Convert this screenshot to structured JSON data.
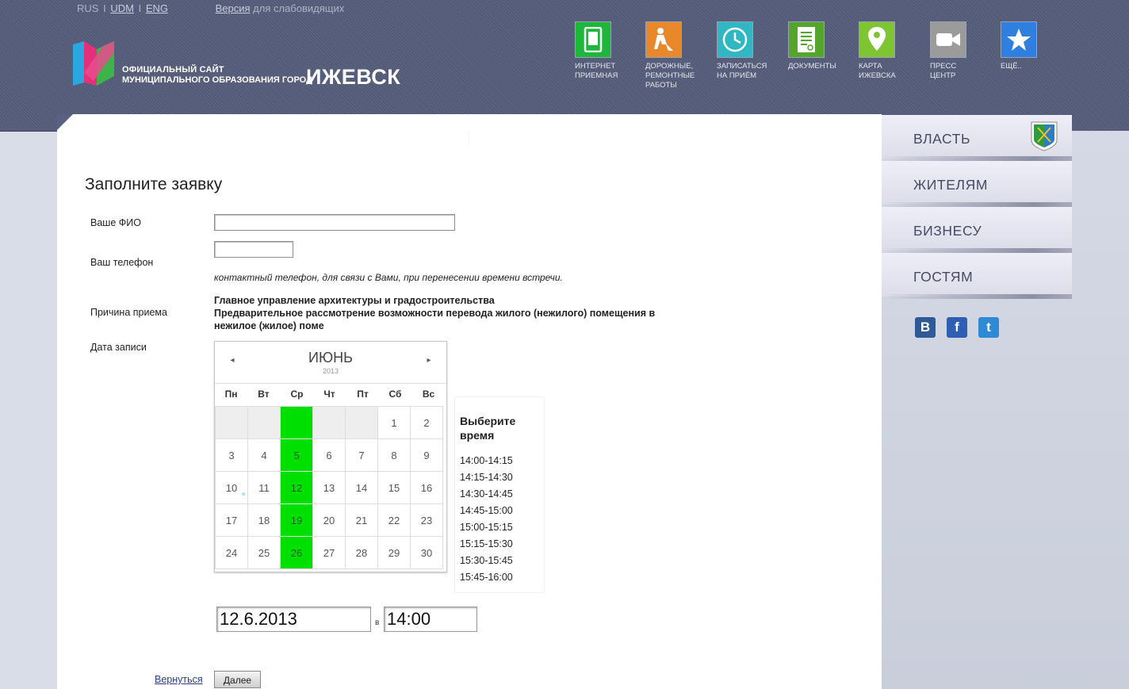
{
  "header": {
    "lang": {
      "rus": "RUS",
      "udm": "UDM",
      "eng": "ENG",
      "sep": "I"
    },
    "version_link": "Версия",
    "version_suffix": "для слабовидящих",
    "logo_line1": "ОФИЦИАЛЬНЫЙ САЙТ",
    "logo_line2": "МУНИЦИПАЛЬНОГО ОБРАЗОВАНИЯ ГОРОД",
    "logo_city": "ИЖЕВСК",
    "quick": [
      {
        "label1": "ИНТЕРНЕТ",
        "label2": "ПРИЕМНАЯ",
        "label3": "",
        "icon": "tablet-icon",
        "color": "#1fb63c"
      },
      {
        "label1": "ДОРОЖНЫЕ,",
        "label2": "РЕМОНТНЫЕ",
        "label3": "РАБОТЫ",
        "icon": "roadwork-icon",
        "color": "#e8882a"
      },
      {
        "label1": "ЗАПИСАТЬСЯ",
        "label2": "НА ПРИЁМ",
        "label3": "",
        "icon": "clock-icon",
        "color": "#2fb8c4"
      },
      {
        "label1": "ДОКУМЕНТЫ",
        "label2": "",
        "label3": "",
        "icon": "document-icon",
        "color": "#53a52b"
      },
      {
        "label1": "КАРТА",
        "label2": "ИЖЕВСКА",
        "label3": "",
        "icon": "map-pin-icon",
        "color": "#7ec433"
      },
      {
        "label1": "ПРЕСС",
        "label2": "ЦЕНТР",
        "label3": "",
        "icon": "camera-icon",
        "color": "#9b9b9b"
      },
      {
        "label1": "ЕЩЁ..",
        "label2": "",
        "label3": "",
        "icon": "star-icon",
        "color": "#2f7fe0"
      }
    ]
  },
  "form": {
    "title": "Заполните заявку",
    "fio_label": "Ваше ФИО",
    "fio_value": "",
    "phone_label": "Ваш телефон",
    "phone_value": "",
    "phone_hint": "контактный телефон, для связи с Вами, при перенесении времени встречи.",
    "reason_label": "Причина приема",
    "reason_line1": "Главное управление архитектуры и градостроительства",
    "reason_line2": "Предварительное рассмотрение возможности перевода жилого (нежилого) помещения в нежилое (жилое) поме",
    "date_label": "Дата записи",
    "selected_date": "12.6.2013",
    "at_label": "в",
    "selected_time": "14:00",
    "back_link": "Вернуться",
    "next_button": "Далее"
  },
  "calendar": {
    "month": "ИЮНЬ",
    "year": "2013",
    "prev": "◂",
    "next": "▸",
    "weekdays": [
      "Пн",
      "Вт",
      "Ср",
      "Чт",
      "Пт",
      "Сб",
      "Вс"
    ],
    "weeks": [
      [
        "",
        "",
        "",
        "",
        "",
        "1",
        "2"
      ],
      [
        "3",
        "4",
        "5",
        "6",
        "7",
        "8",
        "9"
      ],
      [
        "10",
        "11",
        "12",
        "13",
        "14",
        "15",
        "16"
      ],
      [
        "17",
        "18",
        "19",
        "20",
        "21",
        "22",
        "23"
      ],
      [
        "24",
        "25",
        "26",
        "27",
        "28",
        "29",
        "30"
      ]
    ],
    "available_column": "Ср",
    "today_marker_day": "10",
    "available_color": "#00e000"
  },
  "times": {
    "header": "Выберите время",
    "slots": [
      "14:00-14:15",
      "14:15-14:30",
      "14:30-14:45",
      "14:45-15:00",
      "15:00-15:15",
      "15:15-15:30",
      "15:30-15:45",
      "15:45-16:00"
    ]
  },
  "sidebar": {
    "menu": [
      "ВЛАСТЬ",
      "ЖИТЕЛЯМ",
      "БИЗНЕСУ",
      "ГОСТЯМ"
    ],
    "social": [
      {
        "icon": "vk-icon",
        "glyph": "В",
        "color": "#2e5a98"
      },
      {
        "icon": "facebook-icon",
        "glyph": "f",
        "color": "#2f5fb2"
      },
      {
        "icon": "twitter-icon",
        "glyph": "t",
        "color": "#2e8ad4"
      }
    ]
  }
}
